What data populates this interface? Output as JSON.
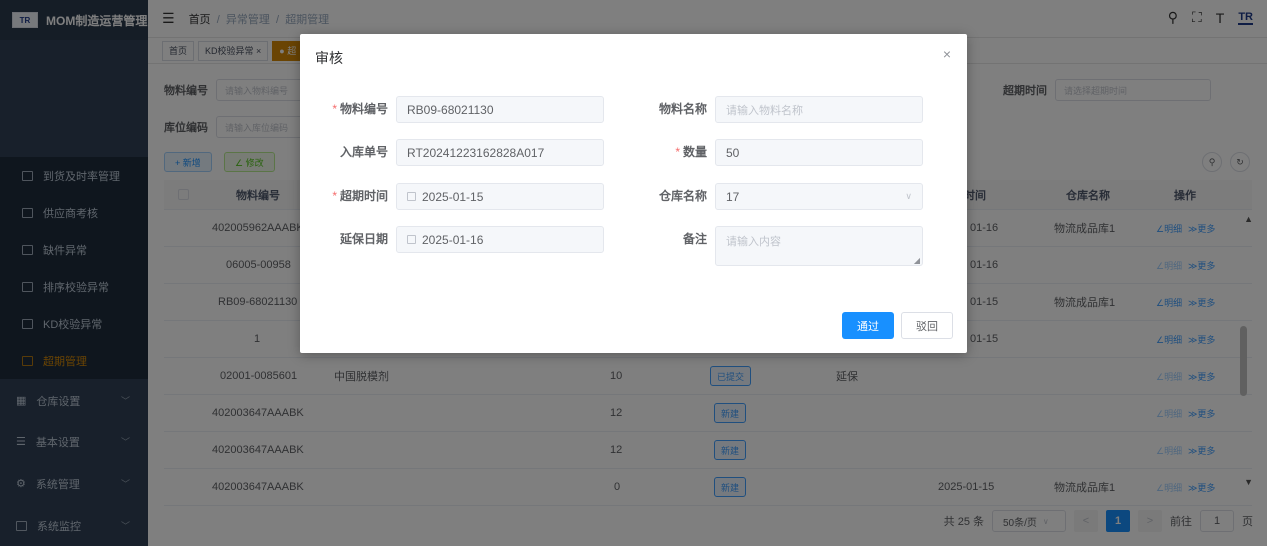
{
  "app": {
    "title": "MOM制造运营管理",
    "logo_text": "TR"
  },
  "sidebar": {
    "items": [
      {
        "label": "到货及时率管理"
      },
      {
        "label": "供应商考核"
      },
      {
        "label": "缺件异常"
      },
      {
        "label": "排序校验异常"
      },
      {
        "label": "KD校验异常"
      },
      {
        "label": "超期管理"
      }
    ],
    "groups": [
      {
        "label": "仓库设置"
      },
      {
        "label": "基本设置"
      },
      {
        "label": "系统管理"
      },
      {
        "label": "系统监控"
      }
    ]
  },
  "header": {
    "breadcrumb": {
      "home": "首页",
      "sep": "/",
      "level1": "异常管理",
      "level2": "超期管理"
    },
    "avatar_text": "TR"
  },
  "tags": [
    {
      "label": "首页"
    },
    {
      "label": "KD校验异常 ×"
    },
    {
      "label": "● 超"
    }
  ],
  "search": {
    "material_code_label": "物料编号",
    "material_code_placeholder": "请输入物料编号",
    "overdue_time_label": "超期时间",
    "overdue_time_placeholder": "请选择超期时间",
    "location_code_label": "库位编码",
    "location_code_placeholder": "请输入库位编码"
  },
  "toolbar": {
    "add_label": "+ 新增",
    "edit_label": "∠ 修改"
  },
  "table": {
    "headers": {
      "material_code": "物料编号",
      "overdue_date": "时间",
      "warehouse": "仓库名称",
      "actions": "操作"
    },
    "rows": [
      {
        "code": "402005962AAABK",
        "name": "",
        "qty": "",
        "status": "",
        "type": "",
        "date": "01-16",
        "warehouse": "物流成品库1",
        "detail": "∠明细",
        "more": "≫更多",
        "active": true
      },
      {
        "code": "06005-00958",
        "name": "",
        "qty": "",
        "status": "",
        "type": "",
        "date": "01-16",
        "warehouse": "",
        "detail": "∠明细",
        "more": "≫更多",
        "active": false
      },
      {
        "code": "RB09-68021130",
        "name": "",
        "qty": "",
        "status": "",
        "type": "",
        "date": "01-15",
        "warehouse": "物流成品库1",
        "detail": "∠明细",
        "more": "≫更多",
        "active": false
      },
      {
        "code": "1",
        "name": "",
        "qty": "",
        "status": "",
        "type": "",
        "date": "01-15",
        "warehouse": "",
        "detail": "∠明细",
        "more": "≫更多",
        "active": false
      },
      {
        "code": "02001-0085601",
        "name": "中国脱模剂",
        "qty": "10",
        "status": "已提交",
        "type": "延保",
        "date": "",
        "warehouse": "",
        "detail": "∠明细",
        "more": "≫更多",
        "active": false
      },
      {
        "code": "402003647AAABK",
        "name": "",
        "qty": "12",
        "status": "新建",
        "type": "",
        "date": "",
        "warehouse": "",
        "detail": "∠明细",
        "more": "≫更多",
        "active": false
      },
      {
        "code": "402003647AAABK",
        "name": "",
        "qty": "12",
        "status": "新建",
        "type": "",
        "date": "",
        "warehouse": "",
        "detail": "∠明细",
        "more": "≫更多",
        "active": false
      },
      {
        "code": "402003647AAABK",
        "name": "",
        "qty": "0",
        "status": "新建",
        "type": "",
        "date": "2025-01-15",
        "warehouse": "物流成品库1",
        "detail": "∠明细",
        "more": "≫更多",
        "active": false
      }
    ]
  },
  "pagination": {
    "total": "共 25 条",
    "page_size": "50条/页",
    "prev": "<",
    "current_page": "1",
    "next": ">",
    "goto_prefix": "前往",
    "goto_value": "1",
    "goto_suffix": "页"
  },
  "modal": {
    "title": "审核",
    "close": "×",
    "fields": {
      "material_code": {
        "label": "物料编号",
        "value": "RB09-68021130",
        "required": "*"
      },
      "material_name": {
        "label": "物料名称",
        "placeholder": "请输入物料名称"
      },
      "inbound_no": {
        "label": "入库单号",
        "value": "RT20241223162828A017"
      },
      "quantity": {
        "label": "数量",
        "value": "50",
        "required": "*"
      },
      "overdue_time": {
        "label": "超期时间",
        "value": "2025-01-15",
        "required": "*"
      },
      "warehouse_name": {
        "label": "仓库名称",
        "value": "17"
      },
      "extension_date": {
        "label": "延保日期",
        "value": "2025-01-16"
      },
      "remark": {
        "label": "备注",
        "placeholder": "请输入内容"
      }
    },
    "approve_label": "通过",
    "reject_label": "驳回"
  },
  "colors": {
    "primary": "#1890ff",
    "sidebar_bg": "#304156",
    "active_menu": "#d48806",
    "required": "#f56c6c"
  }
}
